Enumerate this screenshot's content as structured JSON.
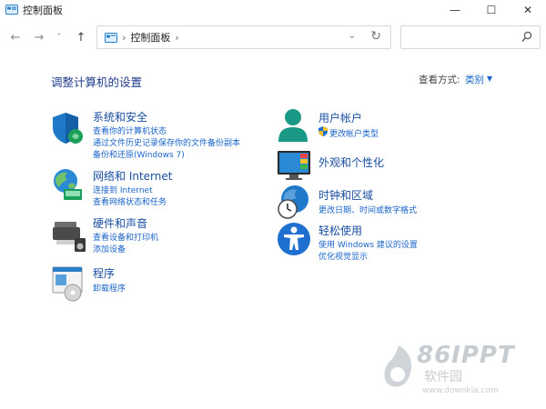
{
  "window": {
    "title": "控制面板",
    "controls": [
      "—",
      "☐",
      "✕"
    ]
  },
  "nav": {
    "back": "←",
    "forward": "→",
    "recent": "˅",
    "up": "↑",
    "breadcrumb": "控制面板",
    "separator": "›",
    "dropdown": "⌄",
    "refresh": "↻",
    "search_placeholder": ""
  },
  "main": {
    "heading": "调整计算机的设置",
    "view_by_label": "查看方式:",
    "view_by_value": "类别",
    "view_by_arrow": "▼"
  },
  "categories_left": [
    {
      "title": "系统和安全",
      "icon": "system-security-icon",
      "links": [
        "查看你的计算机状态",
        "通过文件历史记录保存你的文件备份副本",
        "备份和还原(Windows 7)"
      ]
    },
    {
      "title": "网络和 Internet",
      "icon": "network-icon",
      "links": [
        "连接到 Internet",
        "查看网络状态和任务"
      ]
    },
    {
      "title": "硬件和声音",
      "icon": "hardware-sound-icon",
      "links": [
        "查看设备和打印机",
        "添加设备"
      ]
    },
    {
      "title": "程序",
      "icon": "programs-icon",
      "links": [
        "卸载程序"
      ]
    }
  ],
  "categories_right": [
    {
      "title": "用户帐户",
      "icon": "user-accounts-icon",
      "links": [
        "更改帐户类型"
      ]
    },
    {
      "title": "外观和个性化",
      "icon": "appearance-icon",
      "links": []
    },
    {
      "title": "时钟和区域",
      "icon": "clock-region-icon",
      "links": [
        "更改日期、时间或数字格式"
      ]
    },
    {
      "title": "轻松使用",
      "icon": "ease-of-access-icon",
      "links": [
        "使用 Windows 建议的设置",
        "优化视觉显示"
      ]
    }
  ],
  "watermark": {
    "brand": "86IPPT",
    "cn": "软件园",
    "url": "www.downkia.com"
  },
  "colors": {
    "link": "#1a64c8",
    "title": "#1a4ea0",
    "heading": "#1e3c8c"
  }
}
